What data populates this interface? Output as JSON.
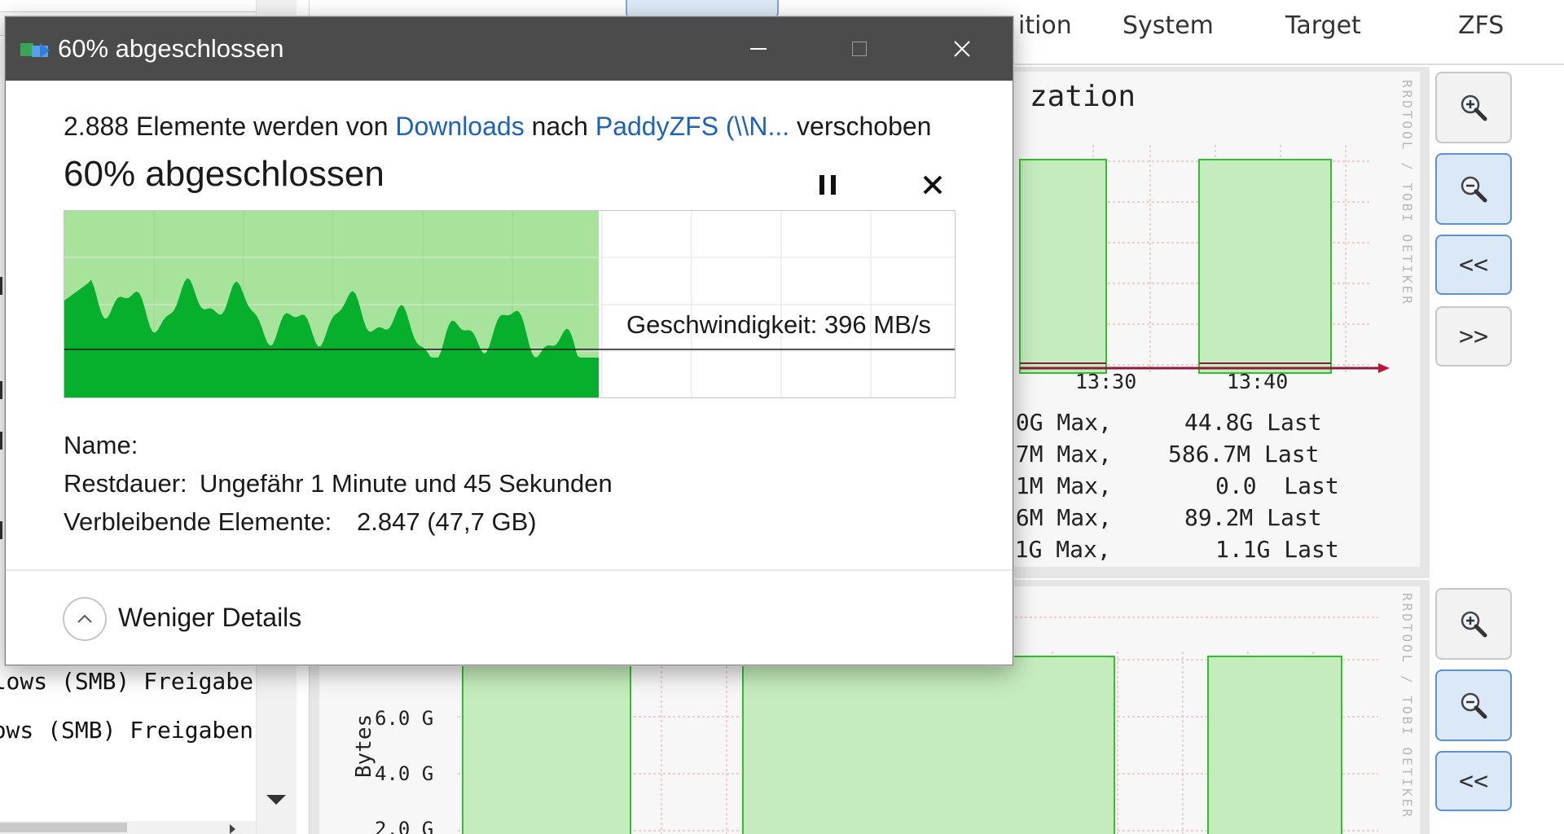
{
  "background": {
    "nav": {
      "items": [
        "ition",
        "System",
        "Target",
        "ZFS"
      ]
    },
    "shares": [
      "lows (SMB) Freigabe",
      "ows (SMB) Freigaben"
    ],
    "graph1": {
      "title_fragment": "zation",
      "credit": "RRDTOOL / TOBI OETIKER",
      "time_ticks": [
        "13:30",
        "13:40"
      ],
      "stats": [
        {
          "max": ".0G Max,",
          "last": "44.8G Last"
        },
        {
          "max": ".7M Max,",
          "last": "586.7M Last"
        },
        {
          "max": ".1M Max,",
          "last": "0.0  Last"
        },
        {
          "max": ".6M Max,",
          "last": "89.2M Last"
        },
        {
          "max": "1.1G Max,",
          "last": "1.1G Last"
        }
      ]
    },
    "graph2": {
      "credit": "RRDTOOL / TOBI OETIKER",
      "ylabel": "Bytes",
      "y_ticks": [
        "6.0 G",
        "4.0 G",
        "2.0 G"
      ]
    },
    "side_buttons": {
      "zoom_in_icon": "zoom-in-icon",
      "zoom_out_icon": "zoom-out-icon",
      "back_label": "<<",
      "forward_label": ">>"
    }
  },
  "dialog": {
    "title": "60% abgeschlossen",
    "app_icon": "file-transfer-icon",
    "subline": {
      "prefix": "2.888 Elemente werden von ",
      "source": "Downloads",
      "middle": " nach ",
      "target": "PaddyZFS (\\\\N...",
      "suffix": " verschoben"
    },
    "status": "60% abgeschlossen",
    "progress_fraction": 0.6,
    "speed_label": "Geschwindigkeit: 396 MB/s",
    "details": {
      "name_label": "Name:",
      "name_value": "",
      "remaining_time_label": "Restdauer:",
      "remaining_time_value": "Ungefähr 1 Minute und 45 Sekunden",
      "remaining_items_label": "Verbleibende Elemente:",
      "remaining_items_value": "2.847 (47,7 GB)"
    },
    "less_details_label": "Weniger Details",
    "colors": {
      "progress_fill": "#a8e39b",
      "speed_area": "#07b02c",
      "titlebar": "#4b4b4b",
      "link": "#1d63b5"
    }
  }
}
